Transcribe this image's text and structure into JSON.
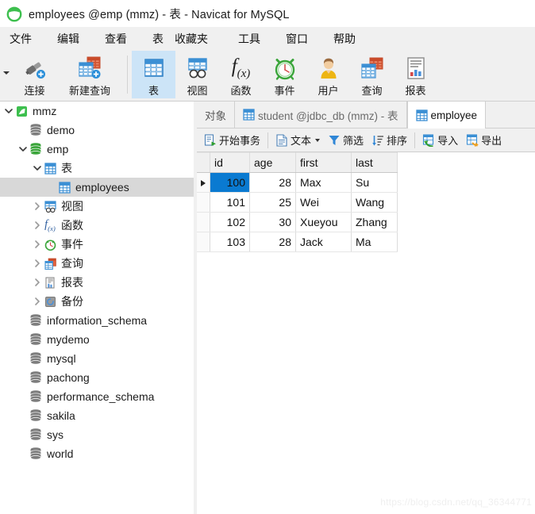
{
  "window": {
    "title": "employees @emp (mmz) - 表 - Navicat for MySQL",
    "logo_icon": "navicat-logo-icon"
  },
  "menubar": {
    "items": [
      {
        "label": "文件",
        "name": "menu-file"
      },
      {
        "label": "编辑",
        "name": "menu-edit"
      },
      {
        "label": "查看",
        "name": "menu-view"
      },
      {
        "label": "表",
        "name": "menu-table"
      },
      {
        "label": "收藏夹",
        "name": "menu-favorites"
      },
      {
        "label": "工具",
        "name": "menu-tools"
      },
      {
        "label": "窗口",
        "name": "menu-window"
      },
      {
        "label": "帮助",
        "name": "menu-help"
      }
    ]
  },
  "ribbon": {
    "buttons": [
      {
        "label": "连接",
        "icon": "connection-plug-icon",
        "active": false
      },
      {
        "label": "新建查询",
        "icon": "new-query-icon",
        "active": false
      },
      {
        "label": "表",
        "icon": "table-icon",
        "active": true
      },
      {
        "label": "视图",
        "icon": "view-icon",
        "active": false
      },
      {
        "label": "函数",
        "icon": "function-fx-icon",
        "active": false
      },
      {
        "label": "事件",
        "icon": "event-clock-icon",
        "active": false
      },
      {
        "label": "用户",
        "icon": "user-icon",
        "active": false
      },
      {
        "label": "查询",
        "icon": "query-icon",
        "active": false
      },
      {
        "label": "报表",
        "icon": "report-icon",
        "active": false
      }
    ]
  },
  "sidebar": {
    "tree": [
      {
        "label": "mmz",
        "icon": "connection-icon",
        "indent": 0,
        "expander": "expanded",
        "selected": false
      },
      {
        "label": "demo",
        "icon": "database-icon",
        "indent": 1,
        "expander": "none",
        "selected": false
      },
      {
        "label": "emp",
        "icon": "database-open-icon",
        "indent": 1,
        "expander": "expanded",
        "selected": false
      },
      {
        "label": "表",
        "icon": "table-icon",
        "indent": 2,
        "expander": "expanded",
        "selected": false
      },
      {
        "label": "employees",
        "icon": "table-icon",
        "indent": 3,
        "expander": "none",
        "selected": true
      },
      {
        "label": "视图",
        "icon": "view-icon",
        "indent": 2,
        "expander": "collapsed",
        "selected": false
      },
      {
        "label": "函数",
        "icon": "function-fx-icon",
        "indent": 2,
        "expander": "collapsed",
        "selected": false
      },
      {
        "label": "事件",
        "icon": "event-clock-icon",
        "indent": 2,
        "expander": "collapsed",
        "selected": false
      },
      {
        "label": "查询",
        "icon": "query-icon",
        "indent": 2,
        "expander": "collapsed",
        "selected": false
      },
      {
        "label": "报表",
        "icon": "report-icon",
        "indent": 2,
        "expander": "collapsed",
        "selected": false
      },
      {
        "label": "备份",
        "icon": "backup-icon",
        "indent": 2,
        "expander": "collapsed",
        "selected": false
      },
      {
        "label": "information_schema",
        "icon": "database-icon",
        "indent": 1,
        "expander": "none",
        "selected": false
      },
      {
        "label": "mydemo",
        "icon": "database-icon",
        "indent": 1,
        "expander": "none",
        "selected": false
      },
      {
        "label": "mysql",
        "icon": "database-icon",
        "indent": 1,
        "expander": "none",
        "selected": false
      },
      {
        "label": "pachong",
        "icon": "database-icon",
        "indent": 1,
        "expander": "none",
        "selected": false
      },
      {
        "label": "performance_schema",
        "icon": "database-icon",
        "indent": 1,
        "expander": "none",
        "selected": false
      },
      {
        "label": "sakila",
        "icon": "database-icon",
        "indent": 1,
        "expander": "none",
        "selected": false
      },
      {
        "label": "sys",
        "icon": "database-icon",
        "indent": 1,
        "expander": "none",
        "selected": false
      },
      {
        "label": "world",
        "icon": "database-icon",
        "indent": 1,
        "expander": "none",
        "selected": false
      }
    ]
  },
  "tabs": [
    {
      "label": "对象",
      "icon": "none",
      "active": false
    },
    {
      "label": "student @jdbc_db (mmz) - 表",
      "icon": "table-icon",
      "active": false
    },
    {
      "label": "employee",
      "icon": "table-icon",
      "active": true
    }
  ],
  "grid_toolbar": {
    "buttons": [
      {
        "label": "开始事务",
        "icon": "begin-transaction-icon",
        "caret": false
      },
      {
        "label": "文本",
        "icon": "text-icon",
        "caret": true
      },
      {
        "label": "筛选",
        "icon": "filter-icon",
        "caret": false
      },
      {
        "label": "排序",
        "icon": "sort-icon",
        "caret": false
      },
      {
        "label": "导入",
        "icon": "import-icon",
        "caret": false
      },
      {
        "label": "导出",
        "icon": "export-icon",
        "caret": false
      }
    ]
  },
  "grid": {
    "columns": [
      "id",
      "age",
      "first",
      "last"
    ],
    "current_column": "id",
    "selected_cell": {
      "row": 0,
      "column": "id"
    },
    "rows": [
      {
        "id": "100",
        "age": "28",
        "first": "Max",
        "last": "Su",
        "current": true
      },
      {
        "id": "101",
        "age": "25",
        "first": "Wei",
        "last": "Wang",
        "current": false
      },
      {
        "id": "102",
        "age": "30",
        "first": "Xueyou",
        "last": "Zhang",
        "current": false
      },
      {
        "id": "103",
        "age": "28",
        "first": "Jack",
        "last": "Ma",
        "current": false
      }
    ]
  },
  "watermark": {
    "text": "https://blog.csdn.net/qq_36344771"
  },
  "colors": {
    "accent_blue": "#0a7ad1",
    "ribbon_bg": "#f0f0f0",
    "active_ribbon": "#cce4f7",
    "selection_gray": "#d8d8d8",
    "current_column_header": "#dbe9f7"
  }
}
